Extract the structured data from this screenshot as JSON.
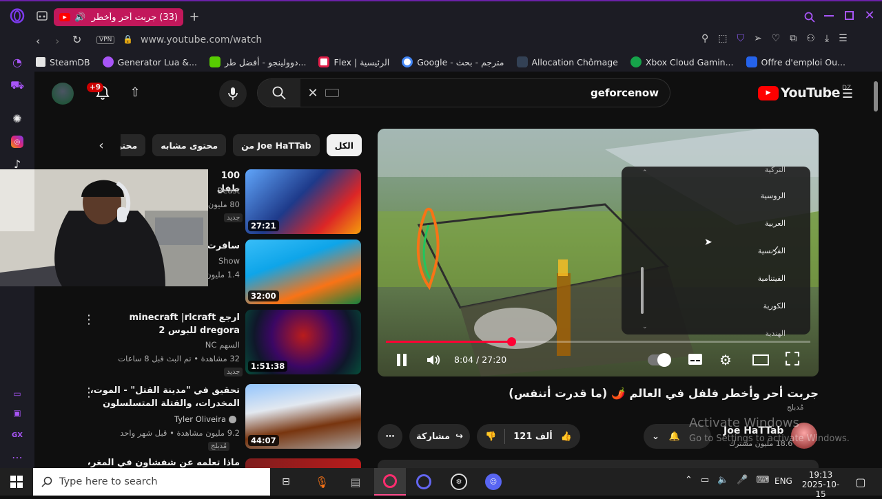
{
  "browser": {
    "tab_title": "(33) جربت أحر وأخطر فلفل",
    "url": "www.youtube.com/watch",
    "vpn_label": "VPN",
    "bookmarks": [
      {
        "label": "SteamDB",
        "color": "#e5e5e5"
      },
      {
        "label": "Generator Lua &...",
        "color": "#a855f7"
      },
      {
        "label": "دوولينجو - أفضل طر...",
        "color": "#58cc02"
      },
      {
        "label": "Flex | الرئيسية",
        "color": "#e11d48"
      },
      {
        "label": "Google - مترجم - بحث",
        "color": "#4285f4"
      },
      {
        "label": "Allocation Chômage",
        "color": "#334155"
      },
      {
        "label": "Xbox Cloud Gamin...",
        "color": "#16a34a"
      },
      {
        "label": "Offre d'emploi Ou...",
        "color": "#2563eb"
      }
    ]
  },
  "youtube": {
    "logo_text": "YouTube",
    "region": "DZ",
    "search_value": "geforcenow",
    "notif_count": "+9",
    "chips": [
      "الكل",
      "من Joe HaTTab",
      "محتوى مشابه",
      "محتوى مقترح"
    ],
    "recommendations": [
      {
        "title": "100 طفل",
        "channel": "Beast",
        "meta": "80 مليون",
        "badge": "جديد",
        "duration": "27:21"
      },
      {
        "title": "سافرت امر",
        "channel": "Show",
        "meta": "1.4 مليون",
        "badge": "",
        "duration": "32:00"
      },
      {
        "title": "ارجع minecraft |rlcraft dregora للبوس 2",
        "channel": "السهم NC",
        "meta": "32 مشاهدة • تم البث قبل 8 ساعات",
        "badge": "جديد",
        "duration": "1:51:38"
      },
      {
        "title": "تحقيق في \"مدينة القتل\" - الموت، المخدرات، والقتلة المتسلسلون",
        "channel": "Tyler Oliveira",
        "meta": "9.2 مليون مشاهدة • قبل شهر واحد",
        "badge": "مُدبلج",
        "duration": "44:07"
      },
      {
        "title": "ماذا تعلمه عن شفشاون في المغرب | المدينة",
        "channel": "",
        "meta": "",
        "badge": "",
        "duration": ""
      }
    ],
    "player": {
      "time": "8:04 / 27:20",
      "progress": 0.295,
      "languages": [
        "التركية",
        "الروسية",
        "العربية",
        "الفرنسية",
        "الفيتنامية",
        "الكورية",
        "الهندية"
      ],
      "selected_language": "الفرنسية"
    },
    "video_title": "جربت أحر وأخطر فلفل في العالم 🌶️ (ما قدرت أتنفس)",
    "dubbed_label": "مُدبلج",
    "likes": "121 ألف",
    "share_label": "مشاركة",
    "channel_name": "Joe HaTTab",
    "subscribers": "18.6 مليون مشترك"
  },
  "watermark": {
    "line1": "Activate Windows",
    "line2": "Go to Settings to activate Windows."
  },
  "taskbar": {
    "search_placeholder": "Type here to search",
    "lang": "ENG",
    "time": "19:13",
    "date": "2025-10-15"
  }
}
